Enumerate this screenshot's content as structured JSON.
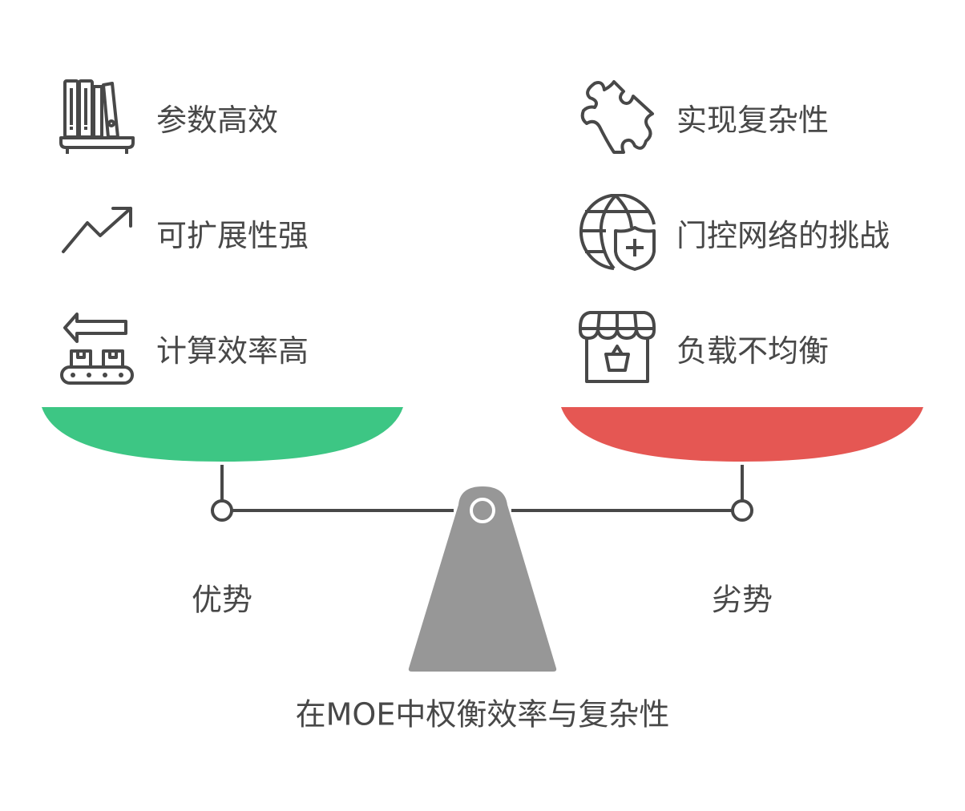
{
  "advantages": {
    "label": "优势",
    "items": [
      {
        "text": "参数高效",
        "icon": "bookshelf-icon"
      },
      {
        "text": "可扩展性强",
        "icon": "trend-up-icon"
      },
      {
        "text": "计算效率高",
        "icon": "conveyor-icon"
      }
    ]
  },
  "disadvantages": {
    "label": "劣势",
    "items": [
      {
        "text": "实现复杂性",
        "icon": "puzzle-icon"
      },
      {
        "text": "门控网络的挑战",
        "icon": "globe-shield-icon"
      },
      {
        "text": "负载不均衡",
        "icon": "store-icon"
      }
    ]
  },
  "title": "在MOE中权衡效率与复杂性",
  "colors": {
    "advantage": "#3DC684",
    "disadvantage": "#E55753",
    "fulcrum": "#979797",
    "ink": "#484848"
  }
}
